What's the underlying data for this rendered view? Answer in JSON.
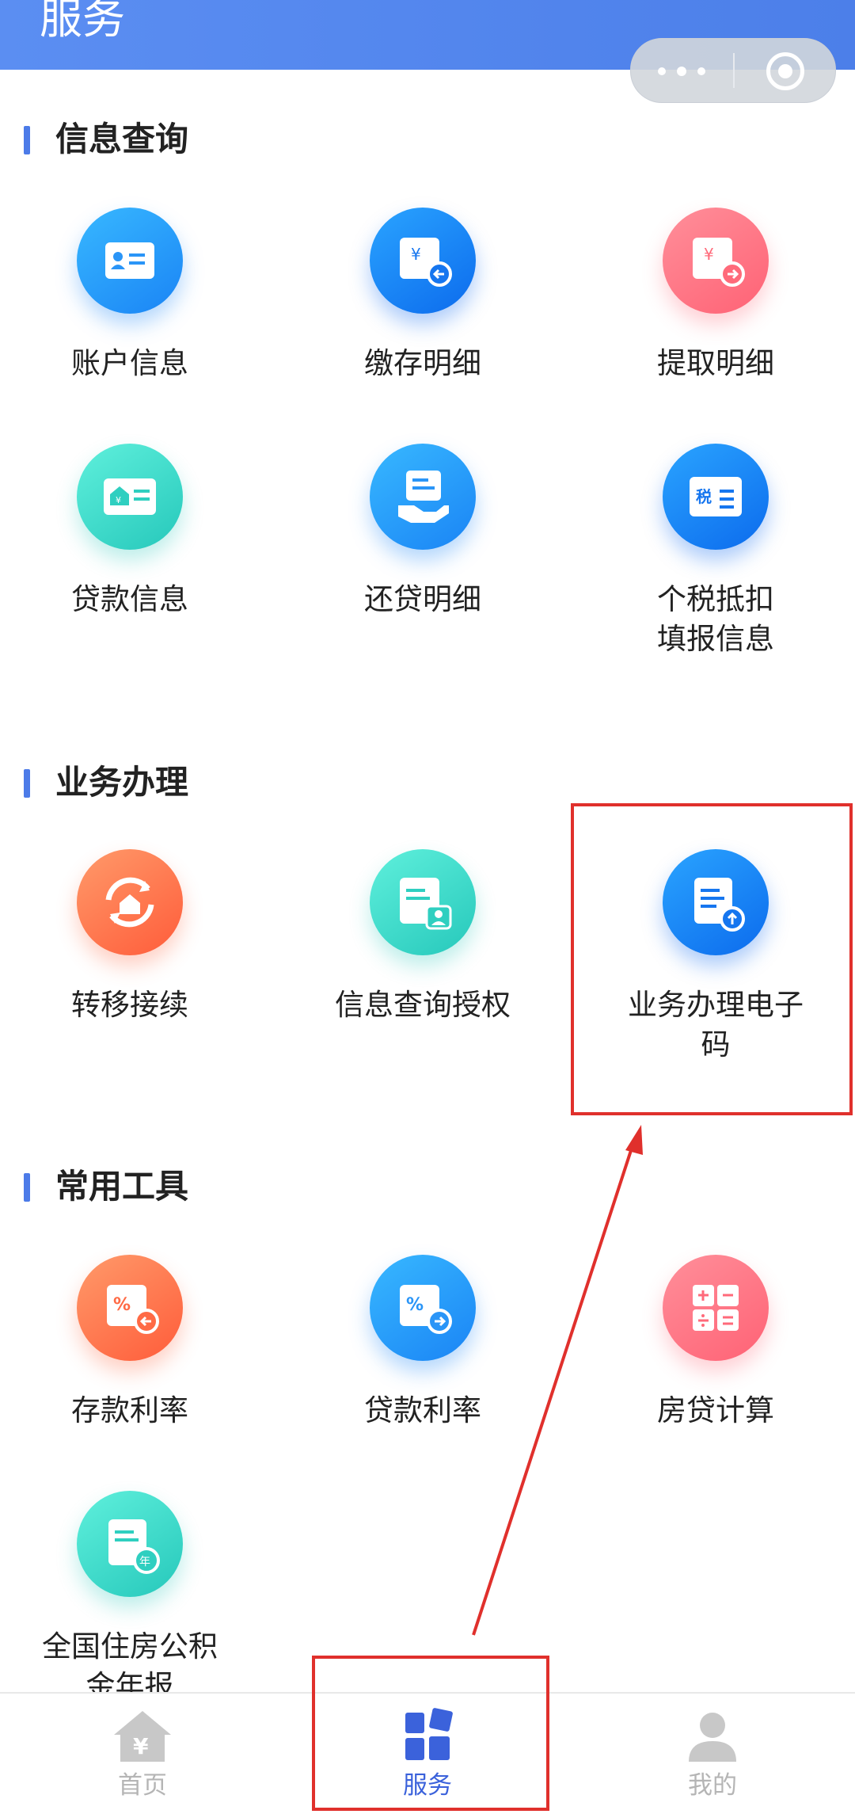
{
  "header": {
    "title": "服务"
  },
  "capsule": {
    "more_icon": "more-dots-icon",
    "close_icon": "target-circle-icon"
  },
  "sections": [
    {
      "title": "信息查询",
      "items": [
        {
          "label": "账户信息",
          "icon": "id-card-icon"
        },
        {
          "label": "缴存明细",
          "icon": "yuan-doc-in-icon"
        },
        {
          "label": "提取明细",
          "icon": "yuan-doc-out-icon"
        },
        {
          "label": "贷款信息",
          "icon": "house-card-icon"
        },
        {
          "label": "还贷明细",
          "icon": "hand-doc-icon"
        },
        {
          "label": "个税抵扣填报信息",
          "label_line1": "个税抵扣",
          "label_line2": "填报信息",
          "icon": "tax-card-icon"
        }
      ]
    },
    {
      "title": "业务办理",
      "items": [
        {
          "label": "转移接续",
          "icon": "house-transfer-icon"
        },
        {
          "label": "信息查询授权",
          "icon": "doc-person-icon"
        },
        {
          "label": "业务办理电子码",
          "label_line1": "业务办理电子",
          "label_line2": "码",
          "icon": "doc-upload-icon"
        }
      ]
    },
    {
      "title": "常用工具",
      "items": [
        {
          "label": "存款利率",
          "icon": "percent-in-icon"
        },
        {
          "label": "贷款利率",
          "icon": "percent-out-icon"
        },
        {
          "label": "房贷计算",
          "icon": "calculator-icon"
        },
        {
          "label": "全国住房公积金年报",
          "label_line1": "全国住房公积",
          "label_line2": "金年报",
          "icon": "doc-year-icon"
        }
      ]
    }
  ],
  "tabbar": {
    "items": [
      {
        "label": "首页",
        "icon": "home-yuan-icon",
        "active": false
      },
      {
        "label": "服务",
        "icon": "services-blocks-icon",
        "active": true
      },
      {
        "label": "我的",
        "icon": "person-icon",
        "active": false
      }
    ]
  },
  "colors": {
    "header": "#5b8ef2",
    "accent": "#3b62db",
    "highlight": "#e0302c"
  }
}
